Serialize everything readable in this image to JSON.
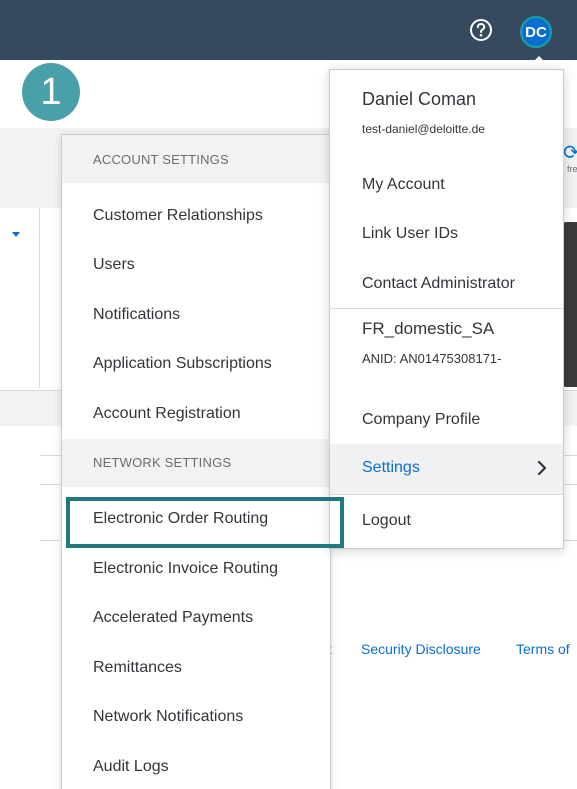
{
  "header": {
    "help_icon": "question-circle-icon",
    "avatar_initials": "DC"
  },
  "step_badge": {
    "number": "1"
  },
  "background": {
    "refresh_icon": "refresh-icon",
    "refresh_partial": "fre",
    "partial_text": "T",
    "footer": {
      "partial_link": "t",
      "security_link": "Security Disclosure",
      "terms_link": "Terms of"
    }
  },
  "settings_menu": {
    "account_header": "ACCOUNT SETTINGS",
    "account_items": [
      "Customer Relationships",
      "Users",
      "Notifications",
      "Application Subscriptions",
      "Account Registration"
    ],
    "network_header": "NETWORK SETTINGS",
    "network_items": [
      "Electronic Order Routing",
      "Electronic Invoice Routing",
      "Accelerated Payments",
      "Remittances",
      "Network Notifications",
      "Audit Logs"
    ],
    "highlight_color": "#20797f"
  },
  "user_menu": {
    "name": "Daniel Coman",
    "email": "test-daniel@deloitte.de",
    "my_account": "My Account",
    "link_user_ids": "Link User IDs",
    "contact_admin": "Contact Administrator",
    "company_name": "FR_domestic_SA",
    "anid": "ANID: AN01475308171-",
    "company_profile": "Company Profile",
    "settings": "Settings",
    "logout": "Logout"
  },
  "colors": {
    "header_bg": "#354a5f",
    "accent": "#0a6ed1",
    "badge": "#4aa0a8"
  }
}
